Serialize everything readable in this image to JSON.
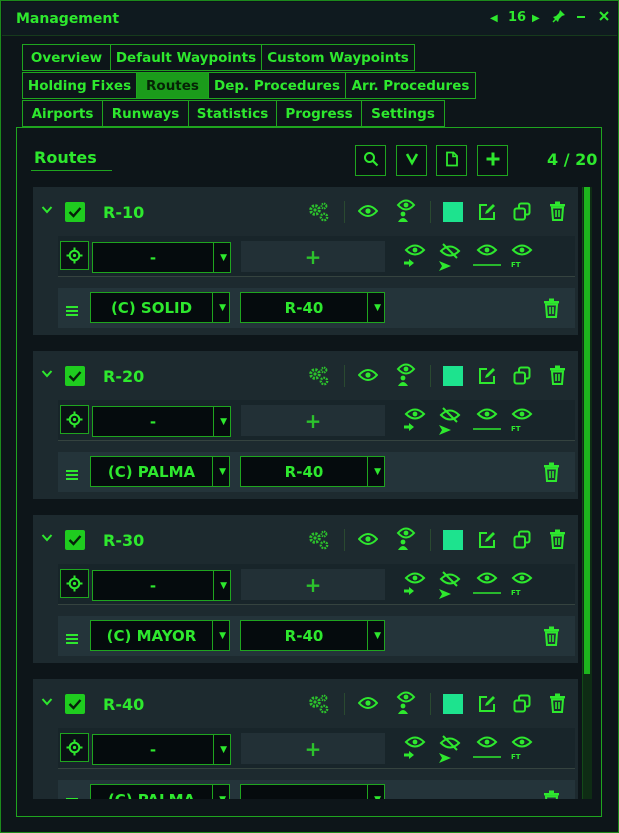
{
  "window": {
    "title": "Management",
    "page_number": "16"
  },
  "tabs": {
    "row1": [
      "Overview",
      "Default Waypoints",
      "Custom Waypoints"
    ],
    "row2": [
      "Holding Fixes",
      "Routes",
      "Dep. Procedures",
      "Arr. Procedures"
    ],
    "row3": [
      "Airports",
      "Runways",
      "Statistics",
      "Progress",
      "Settings"
    ],
    "active": "Routes"
  },
  "section": {
    "title": "Routes",
    "counter": "4 / 20"
  },
  "colors": {
    "accent": "#27d927",
    "route_swatch": "#1de38e",
    "active_tab": "#1b9b1b"
  },
  "icons": {
    "header": [
      "search-icon",
      "filter-icon",
      "document-icon",
      "add-icon"
    ],
    "route_row": [
      "settings-gears-icon",
      "eye-icon",
      "person-pin-icon",
      "edit-icon",
      "copy-icon",
      "trash-icon"
    ],
    "visibility_row": [
      "eye-arrow-icon",
      "eye-slash-arrow-icon",
      "eye-line-icon",
      "eye-ft-icon"
    ]
  },
  "ft_label": "FT",
  "plus_label": "+",
  "routes": [
    {
      "name": "R-10",
      "checked": true,
      "waypoint": "-",
      "segment_type": "(C) SOLID",
      "segment_route": "R-40"
    },
    {
      "name": "R-20",
      "checked": true,
      "waypoint": "-",
      "segment_type": "(C) PALMA",
      "segment_route": "R-40"
    },
    {
      "name": "R-30",
      "checked": true,
      "waypoint": "-",
      "segment_type": "(C) MAYOR",
      "segment_route": "R-40"
    },
    {
      "name": "R-40",
      "checked": true,
      "waypoint": "-",
      "segment_type": "(C) PALMA",
      "segment_route": ""
    }
  ]
}
